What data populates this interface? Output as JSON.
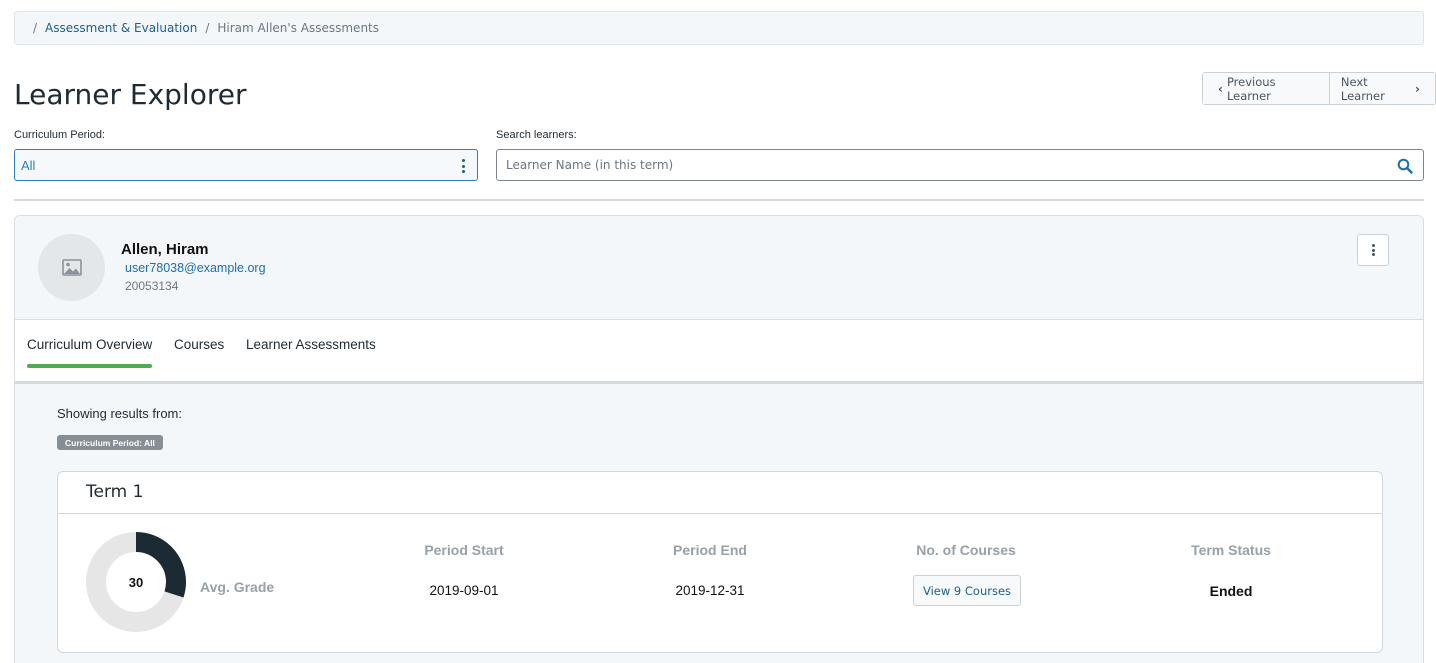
{
  "breadcrumb": {
    "separator": "/",
    "items": [
      {
        "label": "Assessment & Evaluation"
      },
      {
        "label": "Hiram Allen's Assessments"
      }
    ]
  },
  "page": {
    "title": "Learner Explorer"
  },
  "navigation": {
    "previous_label": "Previous Learner",
    "next_label": "Next Learner"
  },
  "filters": {
    "curriculum_period_label": "Curriculum Period:",
    "curriculum_period_value": "All",
    "search_label": "Search learners:",
    "search_placeholder": "Learner Name (in this term)",
    "search_value": ""
  },
  "learner": {
    "name": "Allen, Hiram",
    "email": "user78038@example.org",
    "id_number": "20053134"
  },
  "tabs": [
    {
      "label": "Curriculum Overview",
      "active": true
    },
    {
      "label": "Courses",
      "active": false
    },
    {
      "label": "Learner Assessments",
      "active": false
    }
  ],
  "results": {
    "showing_label": "Showing results from:",
    "badge": "Curriculum Period: All"
  },
  "term": {
    "title": "Term 1",
    "avg_grade_value": "30",
    "avg_grade_percent": 30,
    "avg_grade_label": "Avg. Grade",
    "period_start_label": "Period Start",
    "period_start_value": "2019-09-01",
    "period_end_label": "Period End",
    "period_end_value": "2019-12-31",
    "courses_label": "No. of Courses",
    "courses_button": "View 9 Courses",
    "status_label": "Term Status",
    "status_value": "Ended"
  },
  "colors": {
    "accent_link": "#1b5e93",
    "tab_active": "#4cae4f",
    "donut_fill": "#1c2a33",
    "donut_track": "#e6e6e6"
  },
  "icons": {
    "search": "search-icon",
    "avatar_placeholder": "image-icon",
    "more": "kebab-menu-icon",
    "select_menu": "kebab-menu-icon",
    "prev": "chevron-left-icon",
    "next": "chevron-right-icon"
  }
}
